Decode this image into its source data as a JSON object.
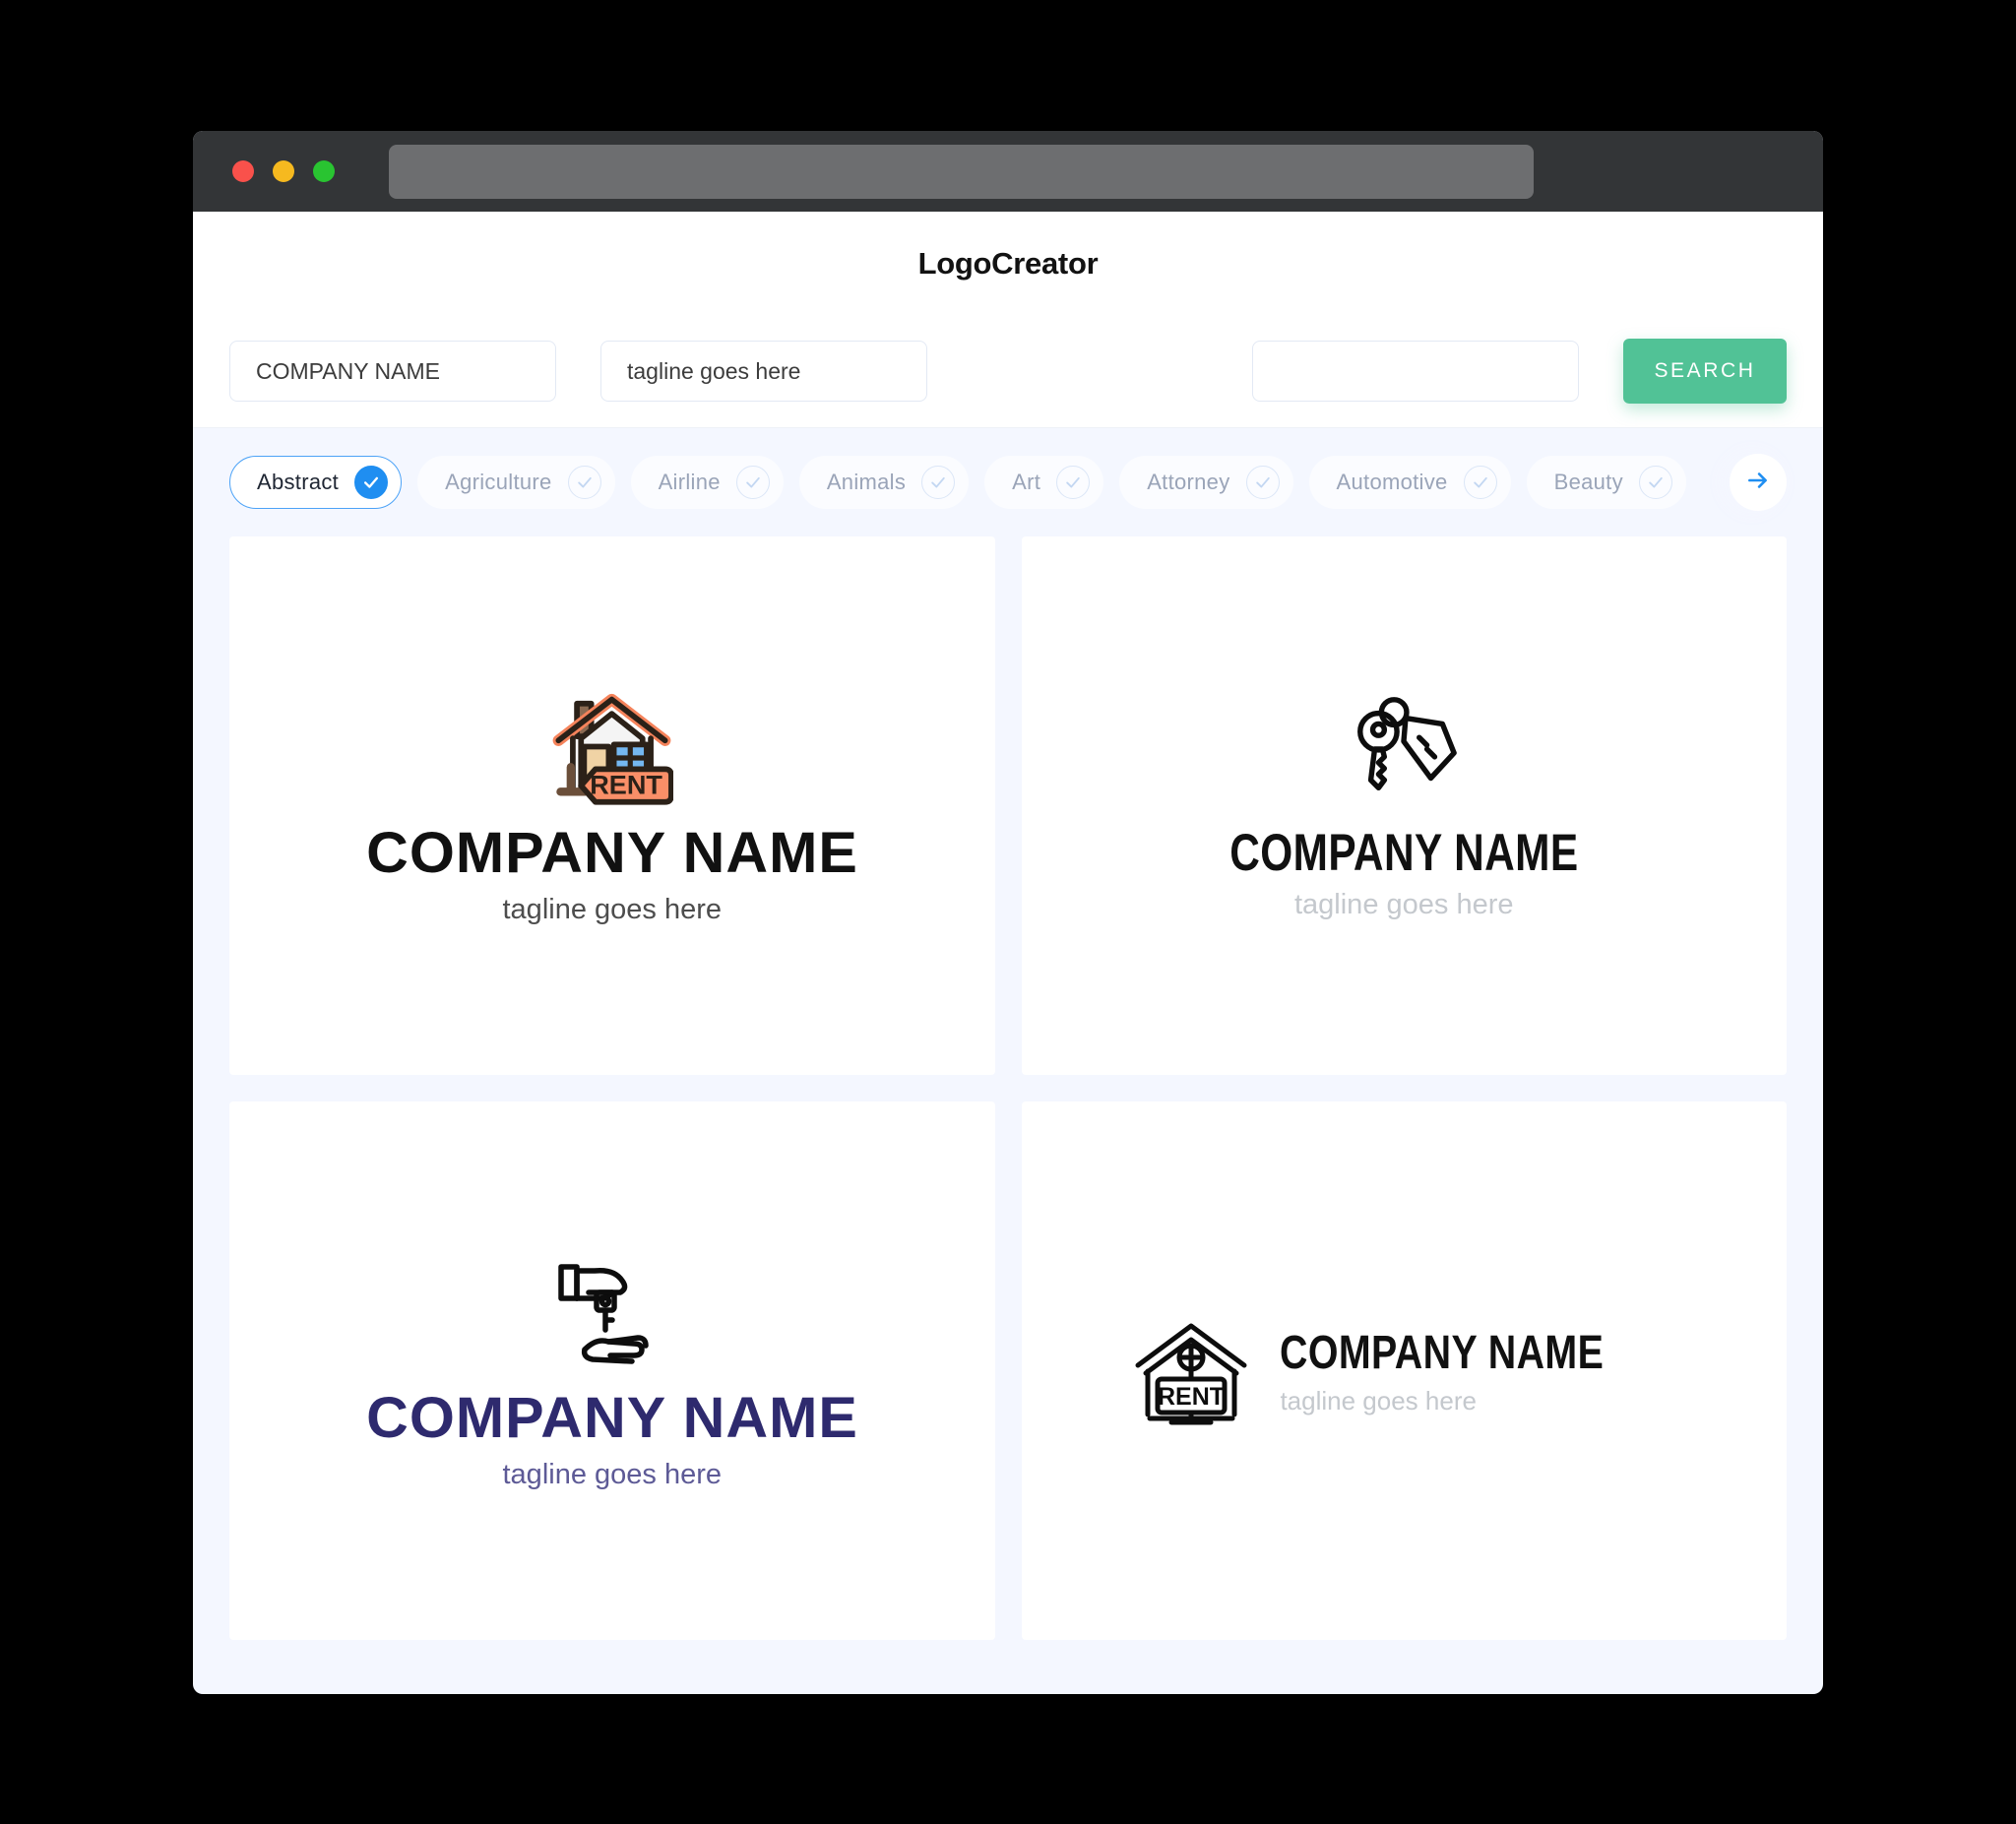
{
  "window": {
    "traffic_lights": [
      "close",
      "minimize",
      "maximize"
    ],
    "url_value": "",
    "url_placeholder": ""
  },
  "header": {
    "title": "LogoCreator"
  },
  "search": {
    "company_value": "COMPANY NAME",
    "company_placeholder": "COMPANY NAME",
    "tagline_value": "tagline goes here",
    "tagline_placeholder": "tagline goes here",
    "keyword_value": "",
    "keyword_placeholder": "",
    "button_label": "SEARCH",
    "button_color": "#51c296"
  },
  "categories": {
    "accent_color": "#1f8ef1",
    "items": [
      {
        "label": "Abstract",
        "selected": true
      },
      {
        "label": "Agriculture",
        "selected": false
      },
      {
        "label": "Airline",
        "selected": false
      },
      {
        "label": "Animals",
        "selected": false
      },
      {
        "label": "Art",
        "selected": false
      },
      {
        "label": "Attorney",
        "selected": false
      },
      {
        "label": "Automotive",
        "selected": false
      },
      {
        "label": "Beauty",
        "selected": false
      }
    ],
    "next_label": "next-categories"
  },
  "results": {
    "cards": [
      {
        "icon": "house-with-rent-tag-icon",
        "layout": "stacked",
        "name": "COMPANY NAME",
        "tagline": "tagline goes here",
        "name_color": "#111111",
        "tagline_color": "#4d4d4d"
      },
      {
        "icon": "key-with-tag-icon",
        "layout": "stacked",
        "name": "COMPANY NAME",
        "tagline": "tagline goes here",
        "name_color": "#111111",
        "tagline_color": "#c4c8cd"
      },
      {
        "icon": "hand-giving-key-icon",
        "layout": "stacked",
        "name": "COMPANY NAME",
        "tagline": "tagline goes here",
        "name_color": "#2e2a6e",
        "tagline_color": "#5d5a96"
      },
      {
        "icon": "house-rent-sign-icon",
        "layout": "inline",
        "name": "COMPANY NAME",
        "tagline": "tagline goes here",
        "name_color": "#111111",
        "tagline_color": "#c4c8cd"
      }
    ],
    "rent_label": "RENT"
  }
}
